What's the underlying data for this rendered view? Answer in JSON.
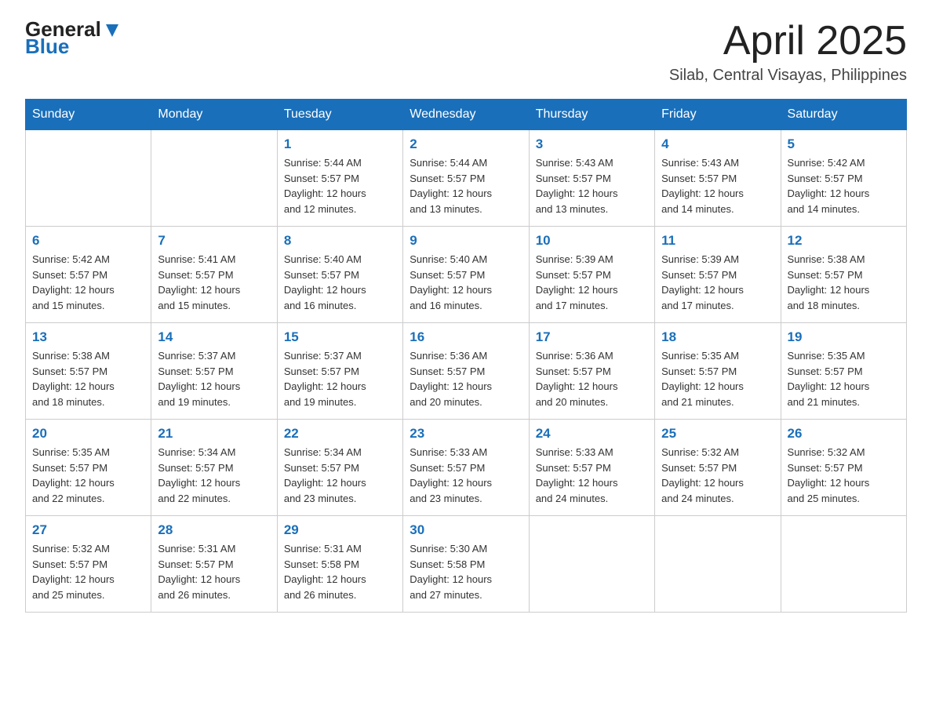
{
  "header": {
    "logo_general": "General",
    "logo_blue": "Blue",
    "month_title": "April 2025",
    "location": "Silab, Central Visayas, Philippines"
  },
  "weekdays": [
    "Sunday",
    "Monday",
    "Tuesday",
    "Wednesday",
    "Thursday",
    "Friday",
    "Saturday"
  ],
  "weeks": [
    [
      {
        "day": "",
        "info": ""
      },
      {
        "day": "",
        "info": ""
      },
      {
        "day": "1",
        "info": "Sunrise: 5:44 AM\nSunset: 5:57 PM\nDaylight: 12 hours\nand 12 minutes."
      },
      {
        "day": "2",
        "info": "Sunrise: 5:44 AM\nSunset: 5:57 PM\nDaylight: 12 hours\nand 13 minutes."
      },
      {
        "day": "3",
        "info": "Sunrise: 5:43 AM\nSunset: 5:57 PM\nDaylight: 12 hours\nand 13 minutes."
      },
      {
        "day": "4",
        "info": "Sunrise: 5:43 AM\nSunset: 5:57 PM\nDaylight: 12 hours\nand 14 minutes."
      },
      {
        "day": "5",
        "info": "Sunrise: 5:42 AM\nSunset: 5:57 PM\nDaylight: 12 hours\nand 14 minutes."
      }
    ],
    [
      {
        "day": "6",
        "info": "Sunrise: 5:42 AM\nSunset: 5:57 PM\nDaylight: 12 hours\nand 15 minutes."
      },
      {
        "day": "7",
        "info": "Sunrise: 5:41 AM\nSunset: 5:57 PM\nDaylight: 12 hours\nand 15 minutes."
      },
      {
        "day": "8",
        "info": "Sunrise: 5:40 AM\nSunset: 5:57 PM\nDaylight: 12 hours\nand 16 minutes."
      },
      {
        "day": "9",
        "info": "Sunrise: 5:40 AM\nSunset: 5:57 PM\nDaylight: 12 hours\nand 16 minutes."
      },
      {
        "day": "10",
        "info": "Sunrise: 5:39 AM\nSunset: 5:57 PM\nDaylight: 12 hours\nand 17 minutes."
      },
      {
        "day": "11",
        "info": "Sunrise: 5:39 AM\nSunset: 5:57 PM\nDaylight: 12 hours\nand 17 minutes."
      },
      {
        "day": "12",
        "info": "Sunrise: 5:38 AM\nSunset: 5:57 PM\nDaylight: 12 hours\nand 18 minutes."
      }
    ],
    [
      {
        "day": "13",
        "info": "Sunrise: 5:38 AM\nSunset: 5:57 PM\nDaylight: 12 hours\nand 18 minutes."
      },
      {
        "day": "14",
        "info": "Sunrise: 5:37 AM\nSunset: 5:57 PM\nDaylight: 12 hours\nand 19 minutes."
      },
      {
        "day": "15",
        "info": "Sunrise: 5:37 AM\nSunset: 5:57 PM\nDaylight: 12 hours\nand 19 minutes."
      },
      {
        "day": "16",
        "info": "Sunrise: 5:36 AM\nSunset: 5:57 PM\nDaylight: 12 hours\nand 20 minutes."
      },
      {
        "day": "17",
        "info": "Sunrise: 5:36 AM\nSunset: 5:57 PM\nDaylight: 12 hours\nand 20 minutes."
      },
      {
        "day": "18",
        "info": "Sunrise: 5:35 AM\nSunset: 5:57 PM\nDaylight: 12 hours\nand 21 minutes."
      },
      {
        "day": "19",
        "info": "Sunrise: 5:35 AM\nSunset: 5:57 PM\nDaylight: 12 hours\nand 21 minutes."
      }
    ],
    [
      {
        "day": "20",
        "info": "Sunrise: 5:35 AM\nSunset: 5:57 PM\nDaylight: 12 hours\nand 22 minutes."
      },
      {
        "day": "21",
        "info": "Sunrise: 5:34 AM\nSunset: 5:57 PM\nDaylight: 12 hours\nand 22 minutes."
      },
      {
        "day": "22",
        "info": "Sunrise: 5:34 AM\nSunset: 5:57 PM\nDaylight: 12 hours\nand 23 minutes."
      },
      {
        "day": "23",
        "info": "Sunrise: 5:33 AM\nSunset: 5:57 PM\nDaylight: 12 hours\nand 23 minutes."
      },
      {
        "day": "24",
        "info": "Sunrise: 5:33 AM\nSunset: 5:57 PM\nDaylight: 12 hours\nand 24 minutes."
      },
      {
        "day": "25",
        "info": "Sunrise: 5:32 AM\nSunset: 5:57 PM\nDaylight: 12 hours\nand 24 minutes."
      },
      {
        "day": "26",
        "info": "Sunrise: 5:32 AM\nSunset: 5:57 PM\nDaylight: 12 hours\nand 25 minutes."
      }
    ],
    [
      {
        "day": "27",
        "info": "Sunrise: 5:32 AM\nSunset: 5:57 PM\nDaylight: 12 hours\nand 25 minutes."
      },
      {
        "day": "28",
        "info": "Sunrise: 5:31 AM\nSunset: 5:57 PM\nDaylight: 12 hours\nand 26 minutes."
      },
      {
        "day": "29",
        "info": "Sunrise: 5:31 AM\nSunset: 5:58 PM\nDaylight: 12 hours\nand 26 minutes."
      },
      {
        "day": "30",
        "info": "Sunrise: 5:30 AM\nSunset: 5:58 PM\nDaylight: 12 hours\nand 27 minutes."
      },
      {
        "day": "",
        "info": ""
      },
      {
        "day": "",
        "info": ""
      },
      {
        "day": "",
        "info": ""
      }
    ]
  ]
}
